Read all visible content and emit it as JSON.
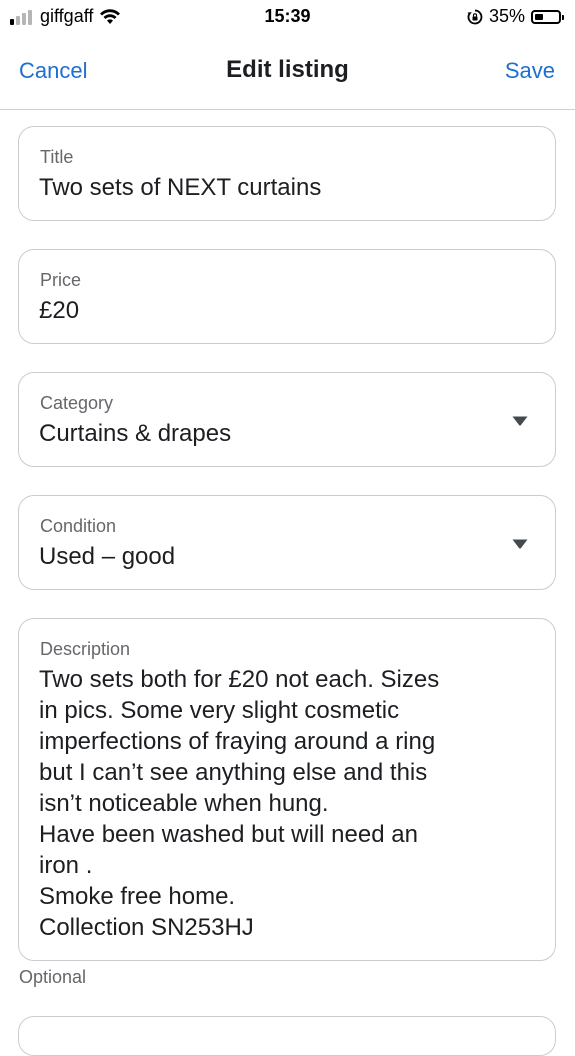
{
  "status_bar": {
    "carrier": "giffgaff",
    "time": "15:39",
    "battery_percent": "35%",
    "battery_level": 0.35,
    "signal_bars_active": 1,
    "signal_bars_total": 4
  },
  "nav": {
    "cancel_label": "Cancel",
    "title": "Edit listing",
    "save_label": "Save",
    "accent_color": "#1d6fd1"
  },
  "form": {
    "title": {
      "label": "Title",
      "value": "Two sets of NEXT curtains"
    },
    "price": {
      "label": "Price",
      "value": "£20"
    },
    "category": {
      "label": "Category",
      "value": "Curtains & drapes",
      "icon": "dropdown-caret-icon"
    },
    "condition": {
      "label": "Condition",
      "value": "Used – good",
      "icon": "dropdown-caret-icon"
    },
    "description": {
      "label": "Description",
      "lines": [
        "Two sets both for £20 not each. Sizes",
        "in pics. Some very slight cosmetic",
        "imperfections of fraying around a ring",
        "but I can’t see anything else and this",
        "isn’t noticeable when hung.",
        "Have been washed but will need an",
        "iron .",
        "Smoke free home.",
        "Collection  SN253HJ"
      ],
      "helper": "Optional"
    }
  }
}
